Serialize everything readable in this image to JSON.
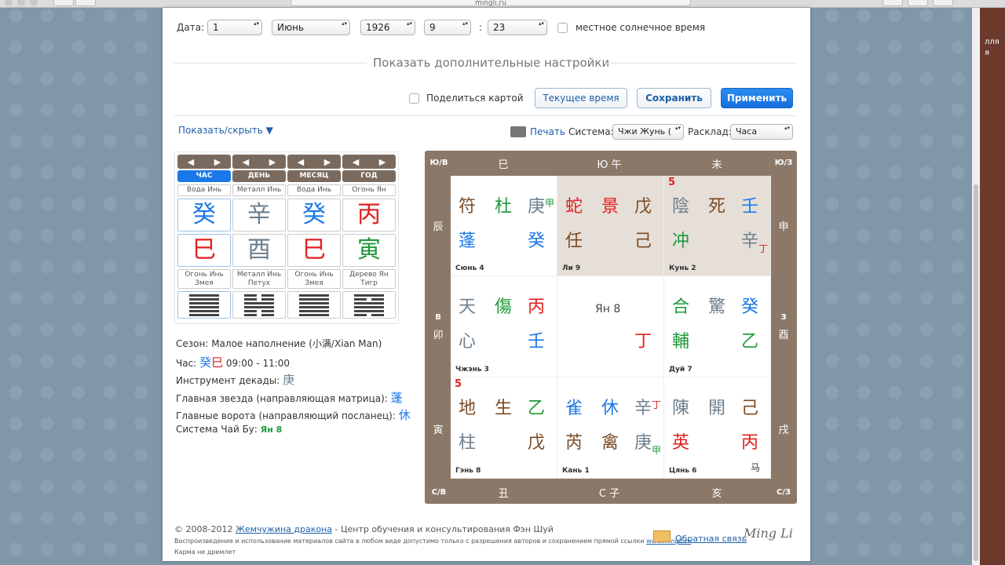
{
  "browser": {
    "url": "mingli.ru"
  },
  "right_strip": {
    "text1": "лля",
    "text2": "я"
  },
  "date": {
    "label": "Дата:",
    "day": "1",
    "month": "Июнь",
    "year": "1926",
    "hour": "9",
    "separator": ":",
    "minute": "23",
    "solar_label": "местное солнечное время"
  },
  "more_settings": "Показать дополнительные настройки",
  "actions": {
    "share_label": "Поделиться картой",
    "current_time": "Текущее время",
    "save": "Сохранить",
    "apply": "Применить"
  },
  "toolbar": {
    "show_hide": "Показать/скрыть ▼",
    "print": "Печать",
    "system_label": "Система:",
    "system_value": "Чжи Жунь (",
    "layout_label": "Расклад:",
    "layout_value": "Часа"
  },
  "pillars": [
    {
      "tag": "ЧАС",
      "active": true,
      "stem_element": "Вода Инь",
      "stem": "癸",
      "stem_color": "#1b78e8",
      "branch": "巳",
      "branch_color": "#e02020",
      "branch_element": "Огонь Инь",
      "branch_animal": "Змея",
      "hex": [
        1,
        1,
        1,
        1,
        1,
        1
      ]
    },
    {
      "tag": "ДЕНЬ",
      "active": false,
      "stem_element": "Металл Инь",
      "stem": "辛",
      "stem_color": "#6e7f8c",
      "branch": "酉",
      "branch_color": "#6e7f8c",
      "branch_element": "Металл Инь",
      "branch_animal": "Петух",
      "hex": [
        0,
        0,
        1,
        1,
        0,
        0
      ]
    },
    {
      "tag": "МЕСЯЦ",
      "active": false,
      "stem_element": "Вода Инь",
      "stem": "癸",
      "stem_color": "#1b78e8",
      "branch": "巳",
      "branch_color": "#e02020",
      "branch_element": "Огонь Инь",
      "branch_animal": "Змея",
      "hex": [
        1,
        1,
        1,
        1,
        1,
        1
      ]
    },
    {
      "tag": "ГОД",
      "active": false,
      "stem_element": "Огонь Ян",
      "stem": "丙",
      "stem_color": "#e02020",
      "branch": "寅",
      "branch_color": "#1e9a3a",
      "branch_element": "Дерево Ян",
      "branch_animal": "Тигр",
      "hex": [
        1,
        0,
        1,
        1,
        1,
        0
      ]
    }
  ],
  "info": {
    "season_label": "Сезон:",
    "season_value": "Малое наполнение (小满/Xian Man)",
    "hour_label": "Час:",
    "hour_chars": "癸巳",
    "hour_range": "09:00 - 11:00",
    "decade_label": "Инструмент декады:",
    "decade_char": "庚",
    "star_label": "Главная звезда (направляющая матрица):",
    "star_char": "蓬",
    "gate_label": "Главные ворота (направляющий посланец):",
    "gate_char": "休",
    "chaibu_label": "Система Чай Бу:",
    "chaibu_value": "Ян 8"
  },
  "board": {
    "corners": {
      "tl": "Ю/В",
      "tr": "Ю/З",
      "bl": "С/В",
      "br": "С/З"
    },
    "top": [
      "巳",
      "Ю 午",
      "未"
    ],
    "bottom": [
      "丑",
      "С 子",
      "亥"
    ],
    "left": [
      "辰",
      "В",
      "卯",
      "寅"
    ],
    "right": [
      "申",
      "З",
      "酉",
      "戌"
    ],
    "center_label": "Ян 8",
    "cells": [
      {
        "name": "Сюнь 4",
        "r1": [
          "符",
          "杜",
          "庚"
        ],
        "r1c": [
          "#7a4a24",
          "#1e9a3a",
          "#6e7f8c"
        ],
        "r1s": "甲",
        "r1sc": "#1e9a3a",
        "r2": [
          "蓬",
          "",
          "癸"
        ],
        "r2c": [
          "#1b78e8",
          "",
          "#1b78e8"
        ],
        "shade": false,
        "num": ""
      },
      {
        "name": "Ли 9",
        "r1": [
          "蛇",
          "景",
          "戊"
        ],
        "r1c": [
          "#e02020",
          "#e02020",
          "#7a4a24"
        ],
        "r1s": "",
        "r1sc": "",
        "r2": [
          "任",
          "",
          "己"
        ],
        "r2c": [
          "#7a4a24",
          "",
          "#7a4a24"
        ],
        "shade": true,
        "num": ""
      },
      {
        "name": "Кунь 2",
        "r1": [
          "陰",
          "死",
          "壬"
        ],
        "r1c": [
          "#6e7f8c",
          "#7a4a24",
          "#1b78e8"
        ],
        "r1s": "",
        "r1sc": "",
        "r2": [
          "冲",
          "",
          "辛"
        ],
        "r2c": [
          "#1e9a3a",
          "",
          "#6e7f8c"
        ],
        "r2s": "丁",
        "r2sc": "#e02020",
        "shade": true,
        "num": "5"
      },
      {
        "name": "Чжэнь 3",
        "r1": [
          "天",
          "傷",
          "丙"
        ],
        "r1c": [
          "#6e7f8c",
          "#1e9a3a",
          "#e02020"
        ],
        "r1s": "",
        "r1sc": "",
        "r2": [
          "心",
          "",
          "壬"
        ],
        "r2c": [
          "#6e7f8c",
          "",
          "#1b78e8"
        ],
        "shade": false,
        "num": ""
      },
      {
        "name": "",
        "r1": [
          "",
          "",
          ""
        ],
        "r1c": [
          "",
          "",
          ""
        ],
        "r1s": "",
        "r1sc": "",
        "r2": [
          "",
          "",
          "丁"
        ],
        "r2c": [
          "",
          "",
          "#e02020"
        ],
        "shade": false,
        "num": "",
        "center": true
      },
      {
        "name": "Дуй 7",
        "r1": [
          "合",
          "驚",
          "癸"
        ],
        "r1c": [
          "#1e9a3a",
          "#6e7f8c",
          "#1b78e8"
        ],
        "r1s": "",
        "r1sc": "",
        "r2": [
          "輔",
          "",
          "乙"
        ],
        "r2c": [
          "#1e9a3a",
          "",
          "#1e9a3a"
        ],
        "shade": false,
        "num": ""
      },
      {
        "name": "Гэнь 8",
        "r1": [
          "地",
          "生",
          "乙"
        ],
        "r1c": [
          "#7a4a24",
          "#7a4a24",
          "#1e9a3a"
        ],
        "r1s": "",
        "r1sc": "",
        "r2": [
          "柱",
          "",
          "戊"
        ],
        "r2c": [
          "#6e7f8c",
          "",
          "#7a4a24"
        ],
        "shade": false,
        "num": "5"
      },
      {
        "name": "Кань 1",
        "r1": [
          "雀",
          "休",
          "辛"
        ],
        "r1c": [
          "#1b78e8",
          "#1b78e8",
          "#6e7f8c"
        ],
        "r1s": "丁",
        "r1sc": "#e02020",
        "r2": [
          "芮",
          "禽",
          "庚"
        ],
        "r2c": [
          "#7a4a24",
          "#7a4a24",
          "#6e7f8c"
        ],
        "r2s": "甲",
        "r2sc": "#1e9a3a",
        "shade": false,
        "num": ""
      },
      {
        "name": "Цянь 6",
        "r1": [
          "陳",
          "開",
          "己"
        ],
        "r1c": [
          "#6e7f8c",
          "#6e7f8c",
          "#7a4a24"
        ],
        "r1s": "",
        "r1sc": "",
        "r2": [
          "英",
          "",
          "丙"
        ],
        "r2c": [
          "#e02020",
          "",
          "#e02020"
        ],
        "shade": false,
        "num": "",
        "horse": "马"
      }
    ]
  },
  "footer": {
    "copyright": "© 2008-2012",
    "link": "Жемчужина дракона",
    "rest": " - Центр обучения и консультирования Фэн Шуй",
    "legal": "Воспроизведение и использование материалов сайта в любом виде допустимо только с разрешения авторов и сохранением прямой ссылки",
    "legal_link": "www.mingli.ru",
    "motto": "Карма не дремлет",
    "feedback": "Обратная связь",
    "logo": "Ming Li"
  }
}
